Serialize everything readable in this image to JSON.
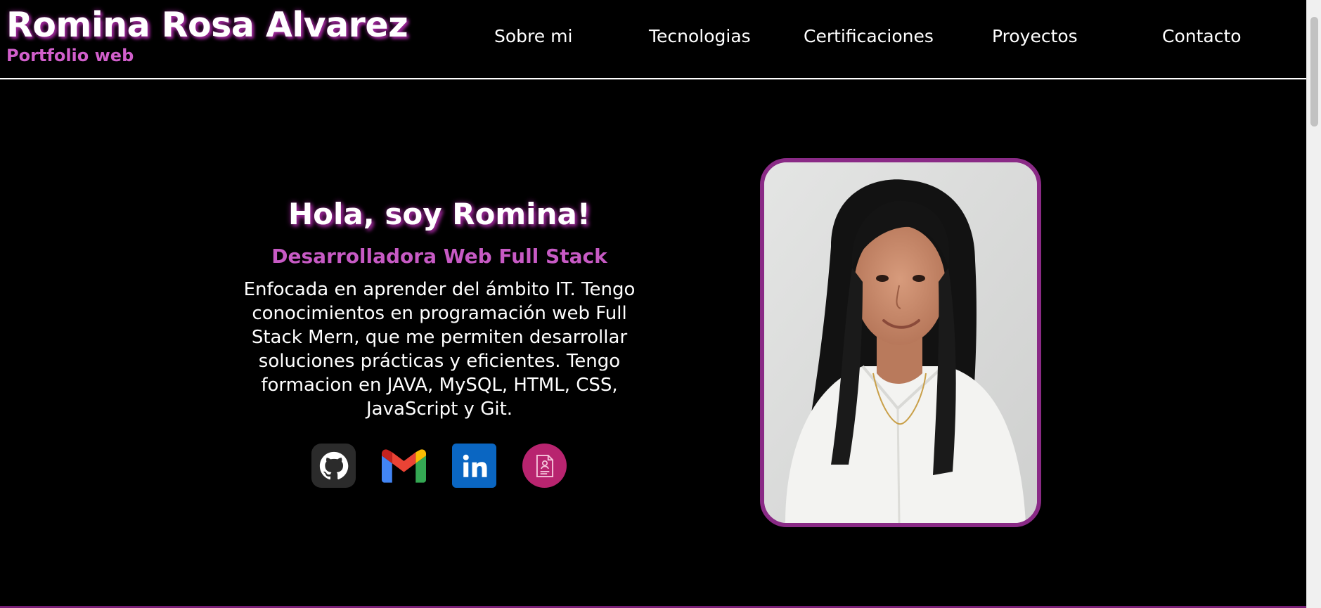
{
  "header": {
    "name": "Romina Rosa Alvarez",
    "subtitle": "Portfolio web"
  },
  "nav": {
    "items": [
      {
        "label": "Sobre mi"
      },
      {
        "label": "Tecnologias"
      },
      {
        "label": "Certificaciones"
      },
      {
        "label": "Proyectos"
      },
      {
        "label": "Contacto"
      }
    ]
  },
  "hero": {
    "title": "Hola, soy Romina!",
    "role": "Desarrolladora Web Full Stack",
    "description": "Enfocada en aprender del ámbito IT. Tengo conocimientos en programación web Full Stack Mern, que me permiten desarrollar soluciones prácticas y eficientes. Tengo formacion en JAVA, MySQL, HTML, CSS, JavaScript y Git."
  },
  "socials": [
    {
      "icon": "github-icon"
    },
    {
      "icon": "gmail-icon"
    },
    {
      "icon": "linkedin-icon"
    },
    {
      "icon": "cv-document-icon"
    }
  ],
  "colors": {
    "accent": "#c75ac4",
    "frame": "#8a2a86",
    "background": "#000000"
  }
}
